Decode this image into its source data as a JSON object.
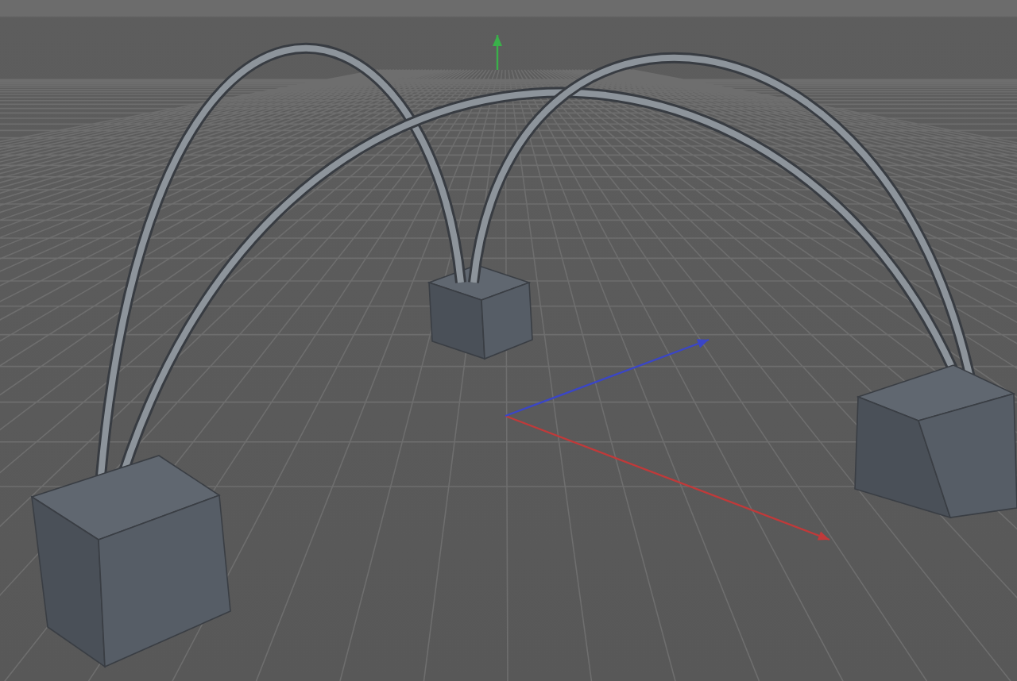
{
  "viewport": {
    "axes": [
      {
        "kind": "x"
      },
      {
        "kind": "z"
      },
      {
        "kind": "y"
      }
    ],
    "objects": [
      {
        "kind": "cube"
      },
      {
        "kind": "tube"
      },
      {
        "kind": "tube"
      },
      {
        "kind": "tube"
      },
      {
        "kind": "cube"
      },
      {
        "kind": "cube"
      }
    ]
  }
}
